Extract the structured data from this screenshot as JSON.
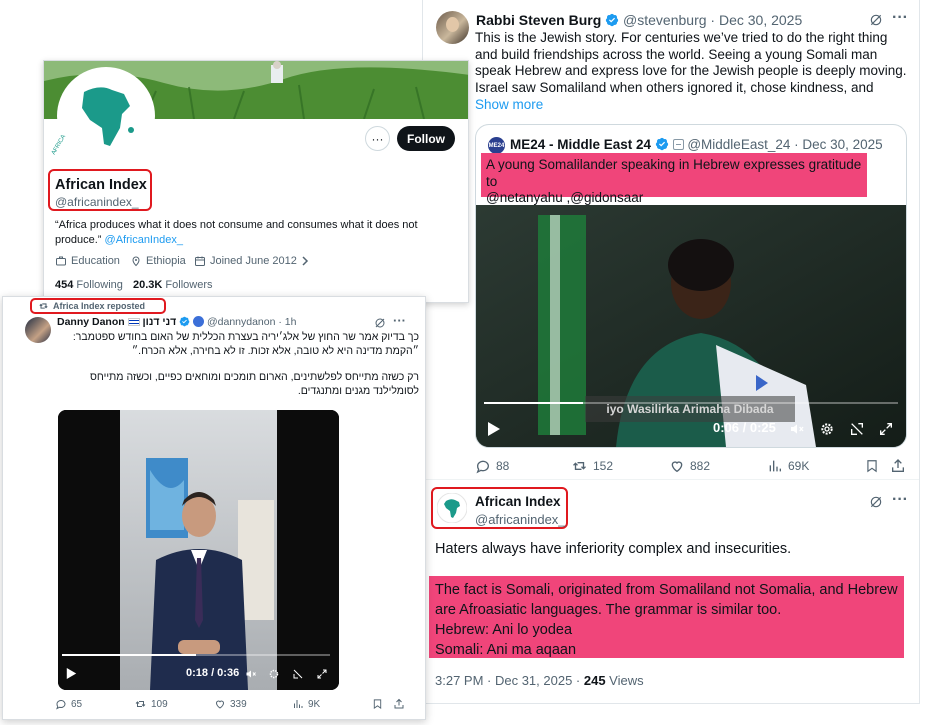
{
  "main_tweet": {
    "author_name": "Rabbi Steven Burg",
    "author_handle": "@stevenburg",
    "date": "· Dec 30, 2025",
    "text": "This is the Jewish story. For centuries we’ve tried to do the right thing and build friendships across the world. Seeing a young Somali man speak Hebrew and express love for the Jewish people is deeply moving. Israel saw Somaliland when others ignored it, chose kindness, and",
    "show_more": "Show more",
    "quote": {
      "avatar_text": "ME24",
      "author_name": "ME24 - Middle East 24",
      "author_handle": "@MiddleEast_24",
      "date": "· Dec 30, 2025",
      "text_line1": "A young Somalilander speaking in Hebrew expresses gratitude to",
      "text_line2": "@netanyahu ,@gidonsaar",
      "video_caption": "iyo Wasilirka Arimaha Dibada",
      "video_time": "0:06 / 0:25",
      "progress": 0.24
    },
    "stats": {
      "replies": "88",
      "reposts": "152",
      "likes": "882",
      "views": "69K"
    }
  },
  "reply_tweet": {
    "author_name": "African Index",
    "author_handle": "@africanindex_",
    "text1": "Haters always have inferiority complex and insecurities.",
    "text2_line1": "The fact is Somali, originated from Somaliland not Somalia, and Hebrew",
    "text2_line2": "are Afroasiatic languages. The grammar is similar too.",
    "text2_line3": "Hebrew: Ani lo yodea",
    "text2_line4": "Somali: Ani ma aqaan",
    "meta_time": "3:27 PM · Dec 31, 2025 · ",
    "meta_views_count": "245",
    "meta_views_label": " Views"
  },
  "profile_card": {
    "avatar_text": "AFRICA",
    "name": "African Index",
    "handle": "@africanindex_",
    "bio": "“Africa produces what it does not consume and consumes what it does not produce.” ",
    "bio_link": "@AfricanIndex_",
    "category": "Education",
    "location": "Ethiopia",
    "joined": "Joined June 2012",
    "following_count": "454",
    "following_label": "Following",
    "followers_count": "20.3K",
    "followers_label": "Followers",
    "follow_button": "Follow",
    "more_button": "···"
  },
  "repost_card": {
    "reposted_label": "Africa Index reposted",
    "author_name": "Danny Danon",
    "author_name_hebrew": "דני דנון",
    "author_handle": "@dannydanon",
    "time": "· 1h",
    "text_line1": "כך בדיוק אמר שר החוץ של אלג׳יריה בעצרת הכללית של האום בחודש ספטמבר:",
    "text_line2": "״הקמת מדינה היא לא טובה, אלא זכות. זו לא בחירה, אלא הכרח.״",
    "text_line3": "רק כשזה מתייחס לפלשתינים, הארום תומכים ומוחאים כפיים, וכשזה מתייחס",
    "text_line4": "לסומלילנד מגנים ומתנגדים.",
    "video_time": "0:18 / 0:36",
    "progress": 0.5,
    "stats": {
      "replies": "65",
      "reposts": "109",
      "likes": "339",
      "views": "9K"
    }
  },
  "colors": {
    "highlight_pink": "#f0457a",
    "red_box": "#e0191f",
    "link_blue": "#1d9bf0",
    "muted": "#536471"
  }
}
